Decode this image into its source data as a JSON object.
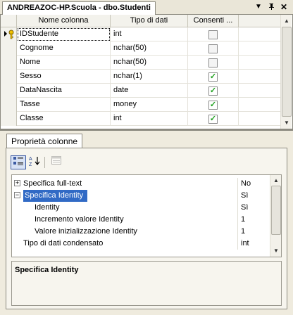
{
  "window": {
    "title": "ANDREAZOC-HP.Scuola - dbo.Studenti",
    "controls": [
      "chevron-down-icon",
      "pin-icon",
      "close-icon"
    ]
  },
  "grid": {
    "columns": [
      "Nome colonna",
      "Tipo di dati",
      "Consenti ..."
    ],
    "rows": [
      {
        "name": "IDStudente",
        "type": "int",
        "nullable": false,
        "primary_key": true
      },
      {
        "name": "Cognome",
        "type": "nchar(50)",
        "nullable": false
      },
      {
        "name": "Nome",
        "type": "nchar(50)",
        "nullable": false
      },
      {
        "name": "Sesso",
        "type": "nchar(1)",
        "nullable": true
      },
      {
        "name": "DataNascita",
        "type": "date",
        "nullable": true
      },
      {
        "name": "Tasse",
        "type": "money",
        "nullable": true
      },
      {
        "name": "Classe",
        "type": "int",
        "nullable": true
      }
    ]
  },
  "properties": {
    "tab_label": "Proprietà colonne",
    "toolbar": [
      "categorized-icon",
      "alphabetical-icon",
      "property-pages-icon"
    ],
    "items": [
      {
        "name": "Specifica full-text",
        "value": "No",
        "level": 0,
        "expander": "+"
      },
      {
        "name": "Specifica Identity",
        "value": "Sì",
        "level": 0,
        "expander": "−",
        "selected": true
      },
      {
        "name": "Identity",
        "value": "Sì",
        "level": 1
      },
      {
        "name": "Incremento valore Identity",
        "value": "1",
        "level": 1
      },
      {
        "name": "Valore inizializzazione Identity",
        "value": "1",
        "level": 1
      },
      {
        "name": "Tipo di dati condensato",
        "value": "int",
        "level": 0
      }
    ],
    "description_title": "Specifica Identity"
  },
  "colors": {
    "selection": "#316ac5",
    "check": "#21a121",
    "panel": "#efebde"
  }
}
